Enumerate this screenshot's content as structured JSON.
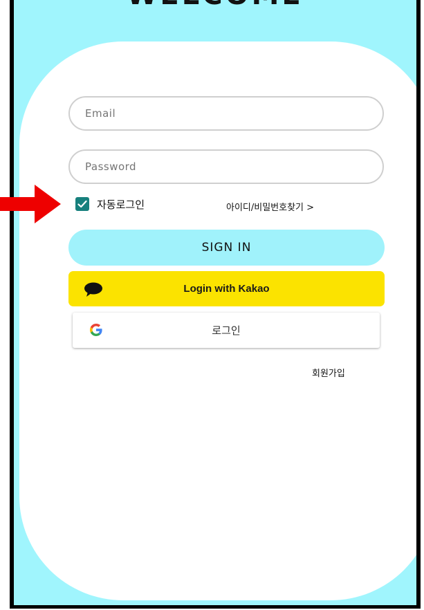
{
  "header": {
    "title": "WELCOME"
  },
  "form": {
    "email_placeholder": "Email",
    "password_placeholder": "Password",
    "auto_login_label": "자동로그인",
    "auto_login_checked": true,
    "find_account_label": "아이디/비밀번호찾기 >"
  },
  "buttons": {
    "sign_in": "SIGN IN",
    "kakao": "Login with Kakao",
    "google": "로그인"
  },
  "links": {
    "signup": "회원가입"
  },
  "colors": {
    "background": "#a0f5fd",
    "sign_in_button": "#a0f2fb",
    "kakao_yellow": "#fbe300",
    "checkbox": "#17807d",
    "annotation_arrow": "#ee0000"
  },
  "icons": {
    "kakao": "speech-bubble-icon",
    "google": "google-g-icon",
    "checkbox": "check-icon",
    "annotation": "red-arrow-icon"
  }
}
